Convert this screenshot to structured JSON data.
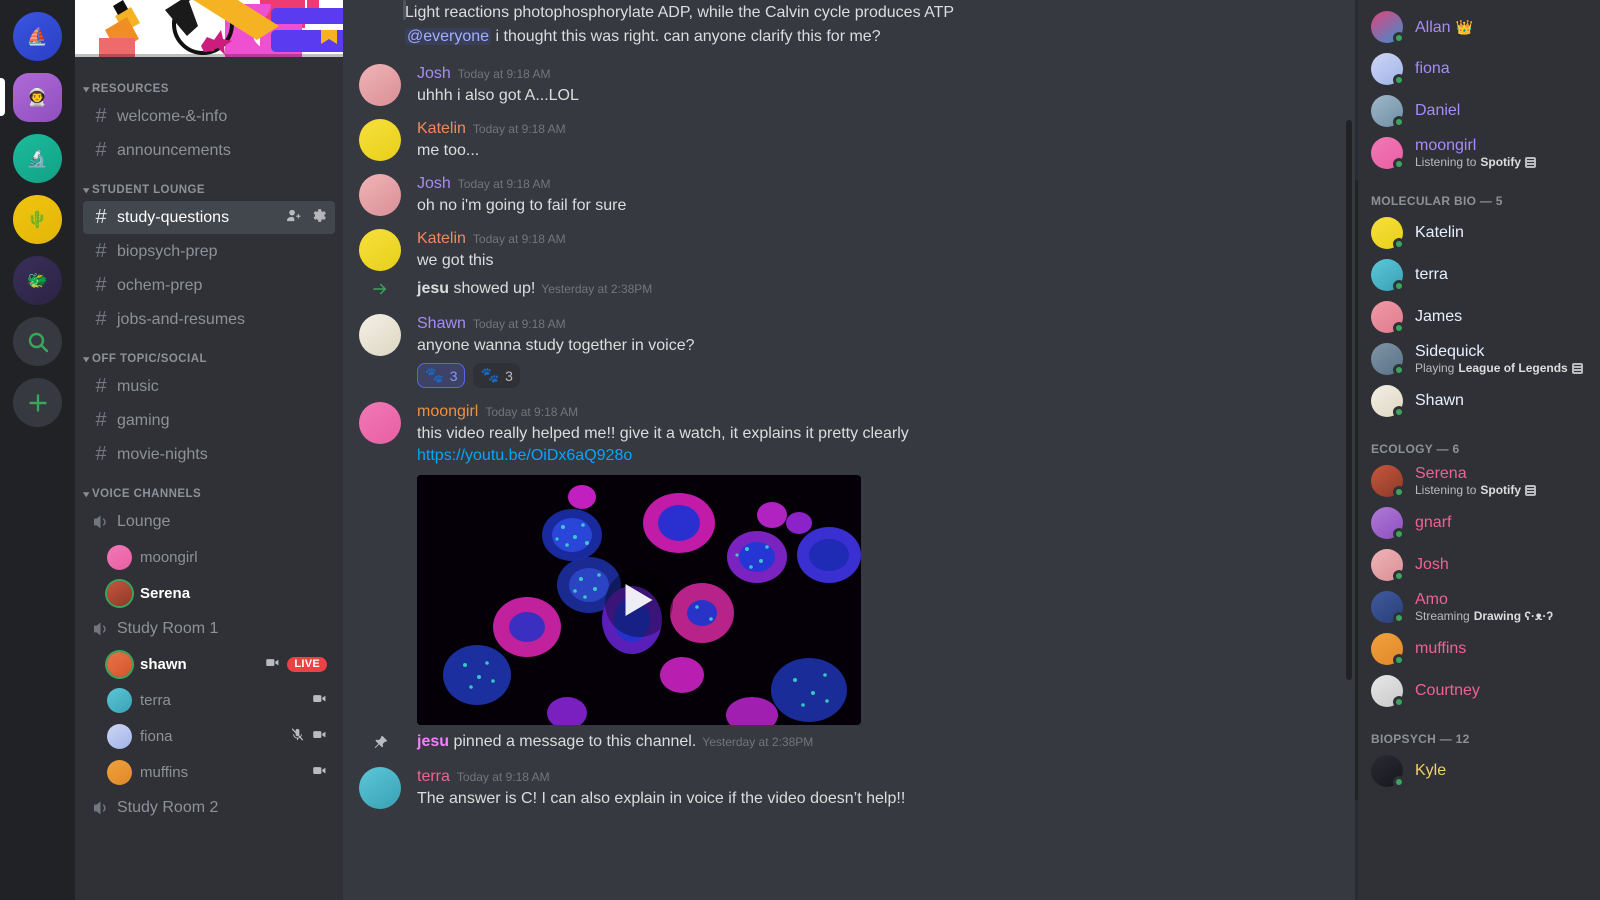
{
  "rail": {
    "servers": [
      {
        "name": "sailboat-server",
        "selected": false,
        "colors": [
          "#3b55e0",
          "#2a3fc4"
        ],
        "glyph": "⛵"
      },
      {
        "name": "astronaut-server",
        "selected": true,
        "colors": [
          "#b06ad6",
          "#8e4fc0"
        ],
        "glyph": "👨‍🚀"
      },
      {
        "name": "science-server",
        "selected": false,
        "colors": [
          "#1abc9c",
          "#14a085"
        ],
        "glyph": "🔬"
      },
      {
        "name": "cactus-server",
        "selected": false,
        "colors": [
          "#f1c40f",
          "#e2b607"
        ],
        "glyph": "🌵"
      },
      {
        "name": "monster-server",
        "selected": false,
        "colors": [
          "#3a2f5a",
          "#2b2344"
        ],
        "glyph": "🐲"
      }
    ],
    "search_label": "Explore servers",
    "add_label": "Add a server"
  },
  "sidebar": {
    "categories": [
      {
        "name": "RESOURCES",
        "channels": [
          {
            "label": "welcome-&-info",
            "active": false
          },
          {
            "label": "announcements",
            "active": false
          }
        ]
      },
      {
        "name": "STUDENT LOUNGE",
        "channels": [
          {
            "label": "study-questions",
            "active": true
          },
          {
            "label": "biopsych-prep",
            "active": false
          },
          {
            "label": "ochem-prep",
            "active": false
          },
          {
            "label": "jobs-and-resumes",
            "active": false
          }
        ]
      },
      {
        "name": "OFF TOPIC/SOCIAL",
        "channels": [
          {
            "label": "music",
            "active": false
          },
          {
            "label": "gaming",
            "active": false
          },
          {
            "label": "movie-nights",
            "active": false
          }
        ]
      }
    ],
    "voice_category": "VOICE CHANNELS",
    "voice_channels": [
      {
        "label": "Lounge",
        "members": [
          {
            "name": "moongirl",
            "speaking": false,
            "video": false,
            "muted": false,
            "live": false,
            "colors": [
              "#f178b6",
              "#e85fa4"
            ]
          },
          {
            "name": "Serena",
            "speaking": true,
            "video": false,
            "muted": false,
            "live": false,
            "colors": [
              "#c8563c",
              "#8a3a2a"
            ]
          }
        ]
      },
      {
        "label": "Study Room 1",
        "members": [
          {
            "name": "shawn",
            "speaking": true,
            "video": true,
            "muted": false,
            "live": true,
            "colors": [
              "#e8734a",
              "#d4552c"
            ]
          },
          {
            "name": "terra",
            "speaking": false,
            "video": true,
            "muted": false,
            "live": false,
            "colors": [
              "#5bc8d8",
              "#3aa0b5"
            ]
          },
          {
            "name": "fiona",
            "speaking": false,
            "video": true,
            "muted": true,
            "live": false,
            "colors": [
              "#cfd6f5",
              "#9fb3e8"
            ]
          },
          {
            "name": "muffins",
            "speaking": false,
            "video": true,
            "muted": false,
            "live": false,
            "colors": [
              "#f0a33c",
              "#e0872a"
            ]
          }
        ]
      },
      {
        "label": "Study Room 2",
        "members": []
      }
    ],
    "live_badge": "LIVE"
  },
  "chat": {
    "quoted_message": "Light reactions photophosphorylate ADP, while the Calvin cycle produces ATP",
    "continuation_mention": "@everyone",
    "continuation_text": " i thought this was right. can anyone clarify this for me?",
    "messages": [
      {
        "type": "message",
        "author": "Josh",
        "color": "#a78bfa",
        "timestamp": "Today at 9:18 AM",
        "text": "uhhh i also got A...LOL",
        "avatar": [
          "#f0b4b8",
          "#d98f95"
        ]
      },
      {
        "type": "message",
        "author": "Katelin",
        "color": "#f08a5d",
        "timestamp": "Today at 9:18 AM",
        "text": "me too...",
        "avatar": [
          "#f7e03c",
          "#e8cf1a"
        ]
      },
      {
        "type": "message",
        "author": "Josh",
        "color": "#a78bfa",
        "timestamp": "Today at 9:18 AM",
        "text": "oh no i'm going to fail for sure",
        "avatar": [
          "#f0b4b8",
          "#d98f95"
        ]
      },
      {
        "type": "message",
        "author": "Katelin",
        "color": "#f08a5d",
        "timestamp": "Today at 9:18 AM",
        "text": "we got this",
        "avatar": [
          "#f7e03c",
          "#e8cf1a"
        ]
      },
      {
        "type": "system_join",
        "user": "jesu",
        "text": " showed up!",
        "timestamp": "Yesterday at 2:38PM"
      },
      {
        "type": "message",
        "author": "Shawn",
        "color": "#a78bfa",
        "timestamp": "Today at 9:18 AM",
        "text": "anyone wanna study together in voice?",
        "avatar": [
          "#f4f0e6",
          "#ddd6c2"
        ],
        "reactions": [
          {
            "emoji": "🐾",
            "count": "3",
            "me": true
          },
          {
            "emoji": "🐾",
            "count": "3",
            "me": false
          }
        ]
      },
      {
        "type": "message",
        "author": "moongirl",
        "color": "#f0903c",
        "timestamp": "Today at 9:18 AM",
        "text": "this video really helped me!! give it a watch, it explains it pretty clearly",
        "link": "https://youtu.be/OiDx6aQ928o",
        "avatar": [
          "#f178b6",
          "#e85fa4"
        ],
        "embed": "cell-microscopy-video"
      },
      {
        "type": "system_pin",
        "user": "jesu",
        "text": " pinned a message to this channel.",
        "timestamp": "Yesterday at 2:38PM"
      },
      {
        "type": "message",
        "author": "terra",
        "color": "#f06292",
        "timestamp": "Today at 9:18 AM",
        "text": "The answer is C! I can also explain in voice if the video doesn’t help!!",
        "avatar": [
          "#5bc8d8",
          "#3aa0b5"
        ]
      }
    ]
  },
  "members": {
    "ungrouped": [
      {
        "name": "Allan",
        "color": "#a78bfa",
        "crown": "👑",
        "status": "",
        "colors": [
          "#e0457b",
          "#3b8ed0"
        ]
      },
      {
        "name": "fiona",
        "color": "#a78bfa",
        "status": "",
        "colors": [
          "#cfd6f5",
          "#9fb3e8"
        ]
      },
      {
        "name": "Daniel",
        "color": "#a78bfa",
        "status": "",
        "colors": [
          "#9fb8c9",
          "#6f8ea3"
        ]
      },
      {
        "name": "moongirl",
        "color": "#a78bfa",
        "status_prefix": "Listening to ",
        "status_app": "Spotify",
        "colors": [
          "#f178b6",
          "#e85fa4"
        ]
      }
    ],
    "groups": [
      {
        "title": "MOLECULAR BIO — 5",
        "people": [
          {
            "name": "Katelin",
            "color": "#e8f0ff",
            "status": "",
            "colors": [
              "#f7e03c",
              "#e8cf1a"
            ]
          },
          {
            "name": "terra",
            "color": "#e8f0ff",
            "status": "",
            "colors": [
              "#5bc8d8",
              "#3aa0b5"
            ]
          },
          {
            "name": "James",
            "color": "#e8f0ff",
            "status": "",
            "colors": [
              "#f09aa8",
              "#e07a8d"
            ]
          },
          {
            "name": "Sidequick",
            "color": "#e8f0ff",
            "status_prefix": "Playing ",
            "status_app": "League of Legends",
            "colors": [
              "#7f95a8",
              "#5a7286"
            ]
          },
          {
            "name": "Shawn",
            "color": "#e8f0ff",
            "status": "",
            "colors": [
              "#f4f0e6",
              "#ddd6c2"
            ]
          }
        ]
      },
      {
        "title": "ECOLOGY — 6",
        "people": [
          {
            "name": "Serena",
            "color": "#f06292",
            "status_prefix": "Listening to ",
            "status_app": "Spotify",
            "colors": [
              "#c8563c",
              "#8a3a2a"
            ]
          },
          {
            "name": "gnarf",
            "color": "#f06292",
            "status": "",
            "colors": [
              "#b07ad6",
              "#8e4fc0"
            ]
          },
          {
            "name": "Josh",
            "color": "#f06292",
            "status": "",
            "colors": [
              "#f0b4b8",
              "#d98f95"
            ]
          },
          {
            "name": "Amo",
            "color": "#f06292",
            "status_prefix": "Streaming ",
            "status_app": "Drawing ʕ·ᴥ·ʔ",
            "no_icon": true,
            "colors": [
              "#3f5a9e",
              "#2b3f78"
            ]
          },
          {
            "name": "muffins",
            "color": "#f06292",
            "status": "",
            "colors": [
              "#f0a33c",
              "#e0872a"
            ]
          },
          {
            "name": "Courtney",
            "color": "#f06292",
            "status": "",
            "colors": [
              "#e8e8e8",
              "#c8c8c8"
            ]
          }
        ]
      },
      {
        "title": "BIOPSYCH — 12",
        "people": [
          {
            "name": "Kyle",
            "color": "#f0d264",
            "status": "",
            "colors": [
              "#2b2b33",
              "#16161c"
            ]
          }
        ]
      }
    ]
  },
  "colors": {
    "rail_bg": "#202225",
    "sidebar_bg": "#2f3136",
    "chat_bg": "#36393f",
    "active_channel_bg": "#42464d",
    "online_green": "#3ba55d",
    "live_red": "#ed4245",
    "link_blue": "#00a8fc",
    "blurple": "#5865f2"
  }
}
